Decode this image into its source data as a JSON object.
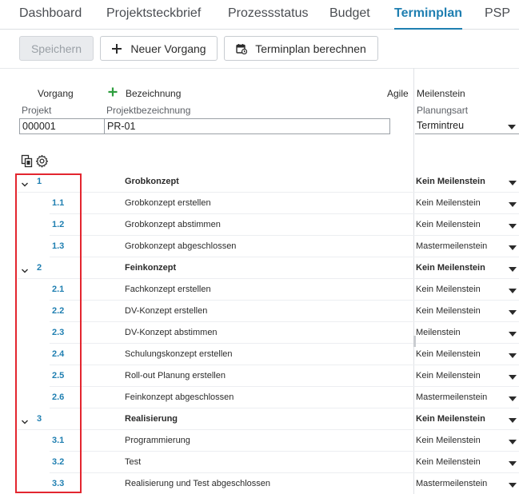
{
  "tabs": [
    {
      "label": "Dashboard",
      "active": false
    },
    {
      "label": "Projektsteckbrief",
      "active": false
    },
    {
      "label": "Prozessstatus",
      "active": false
    },
    {
      "label": "Budget",
      "active": false
    },
    {
      "label": "Terminplan",
      "active": true
    },
    {
      "label": "PSP",
      "active": false
    }
  ],
  "toolbar": {
    "save_label": "Speichern",
    "new_task_label": "Neuer Vorgang",
    "calculate_label": "Terminplan berechnen"
  },
  "header": {
    "col_vorgang": "Vorgang",
    "col_bezeichnung": "Bezeichnung",
    "col_agile": "Agile",
    "col_meilenstein": "Meilenstein",
    "projekt_label": "Projekt",
    "projektbezeichnung_label": "Projektbezeichnung",
    "planungsart_label": "Planungsart",
    "projekt_value": "000001",
    "projektbezeichnung_value": "PR-01",
    "planungsart_value": "Termintreu"
  },
  "icons": {
    "copy": "copy-icon",
    "settings": "gear-icon",
    "add": "plus-icon",
    "calendar": "calendar-icon",
    "expand": "chevron-down-icon",
    "dropdown": "caret-down-icon"
  },
  "colors": {
    "accent": "#1f7fb1",
    "add_green": "#2e9e3e",
    "highlight": "#e3262f"
  },
  "rows": [
    {
      "id": "1",
      "name": "Grobkonzept",
      "milestone": "Kein Meilenstein",
      "top": true
    },
    {
      "id": "1.1",
      "name": "Grobkonzept erstellen",
      "milestone": "Kein Meilenstein",
      "top": false
    },
    {
      "id": "1.2",
      "name": "Grobkonzept abstimmen",
      "milestone": "Kein Meilenstein",
      "top": false
    },
    {
      "id": "1.3",
      "name": "Grobkonzept abgeschlossen",
      "milestone": "Mastermeilenstein",
      "top": false
    },
    {
      "id": "2",
      "name": "Feinkonzept",
      "milestone": "Kein Meilenstein",
      "top": true
    },
    {
      "id": "2.1",
      "name": "Fachkonzept erstellen",
      "milestone": "Kein Meilenstein",
      "top": false
    },
    {
      "id": "2.2",
      "name": "DV-Konzept erstellen",
      "milestone": "Kein Meilenstein",
      "top": false
    },
    {
      "id": "2.3",
      "name": "DV-Konzept abstimmen",
      "milestone": "Meilenstein",
      "top": false
    },
    {
      "id": "2.4",
      "name": "Schulungskonzept erstellen",
      "milestone": "Kein Meilenstein",
      "top": false
    },
    {
      "id": "2.5",
      "name": "Roll-out Planung erstellen",
      "milestone": "Kein Meilenstein",
      "top": false
    },
    {
      "id": "2.6",
      "name": "Feinkonzept abgeschlossen",
      "milestone": "Mastermeilenstein",
      "top": false
    },
    {
      "id": "3",
      "name": "Realisierung",
      "milestone": "Kein Meilenstein",
      "top": true
    },
    {
      "id": "3.1",
      "name": "Programmierung",
      "milestone": "Kein Meilenstein",
      "top": false
    },
    {
      "id": "3.2",
      "name": "Test",
      "milestone": "Kein Meilenstein",
      "top": false
    },
    {
      "id": "3.3",
      "name": "Realisierung und Test abgeschlossen",
      "milestone": "Mastermeilenstein",
      "top": false
    }
  ]
}
